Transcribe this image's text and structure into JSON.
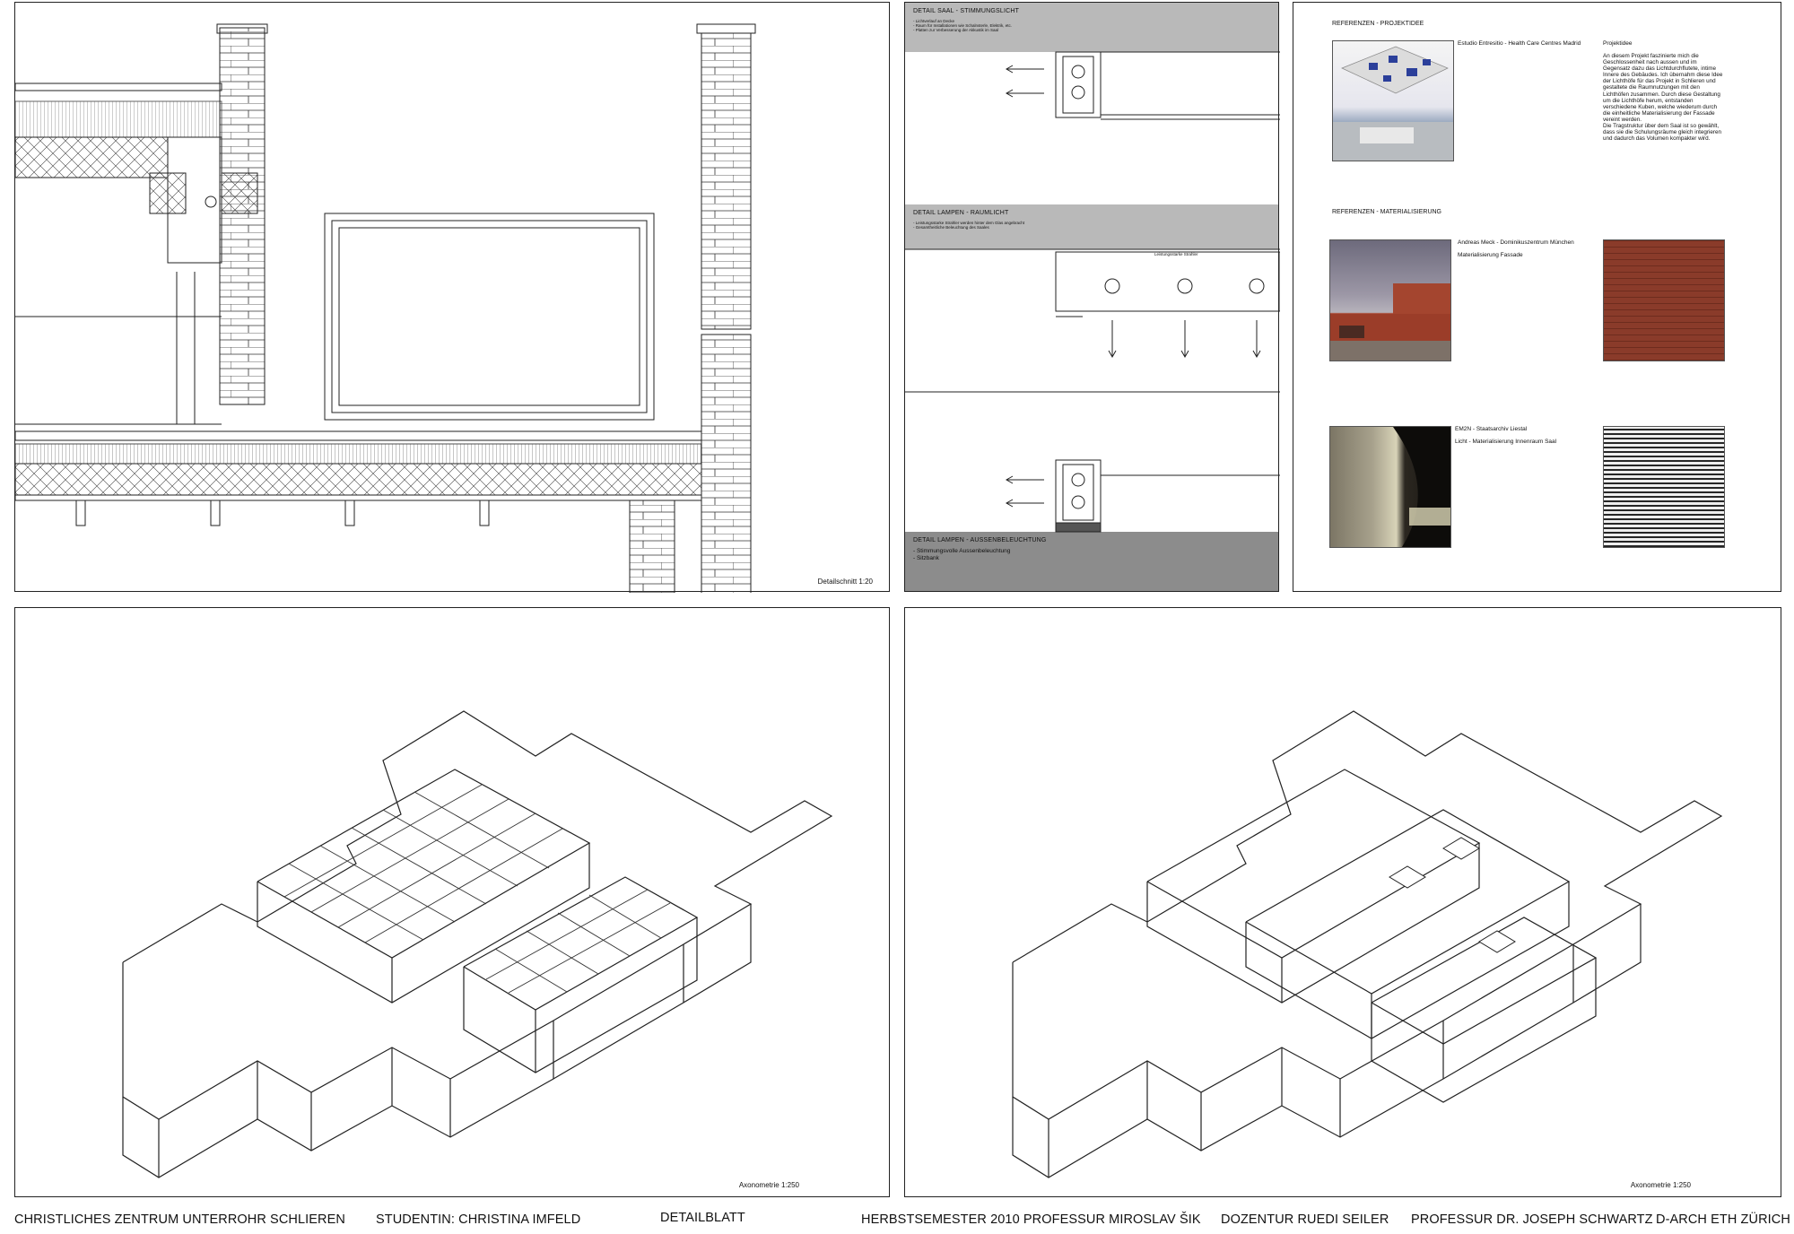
{
  "section_sheet": {
    "caption": "Detailschnitt 1:20"
  },
  "detail_sheet": {
    "band1": {
      "title": "DETAIL SAAL - STIMMUNGSLICHT",
      "items": [
        "- Lichtverlauf an Decke",
        "- Raum für Installationen wie Schalnsterle, Elektrik, etc.",
        "- Platten zur Verbesserung der Akkustik im Saal"
      ]
    },
    "band2": {
      "title": "DETAIL LAMPEN - RAUMLICHT",
      "items": [
        "- Leistungsstarke Strahler werden hinter dem Glas angebracht",
        "- Gesamtheitliche Beleuchtung des Saales"
      ]
    },
    "lamp_label": "Leistungsstarke Strahler",
    "band3": {
      "title": "DETAIL LAMPEN - AUSSENBELEUCHTUNG",
      "items": [
        "- Stimmungsvolle Aussenbeleuchtung",
        "- Sitzbank"
      ]
    }
  },
  "references": {
    "head1": "REFERENZEN - PROJEKTIDEE",
    "ref1_title": "Estudio Entresitio - Health Care Centres Madrid",
    "idea_title": "Projektidee",
    "idea_lines": [
      "An diesem Projekt faszinierte mich die",
      "Geschlossenheit nach aussen und im",
      "Gegensatz dazu das Lichtdurchflutete, intime",
      "Innere des Gebäudes. Ich übernahm diese Idee",
      "der Lichthöfe für das Projekt in Schlieren und",
      "gestaltete die Raumnutzungen mit den",
      "Lichthöfen zusammen. Durch diese Gestaltung",
      "um die Lichthöfe herum, entstanden",
      "verschiedene Kuben, welche wiederum durch",
      "die einheitliche Materialisierung der Fassade",
      "vereint werden.",
      "Die Tragstruktur über dem Saal ist so gewählt,",
      "dass sie die Schulungsräume gleich integrieren",
      "und dadurch das Volumen kompakter wird."
    ],
    "head2": "REFERENZEN - MATERIALISIERUNG",
    "ref2_title": "Andreas Meck - Dominikuszentrum München",
    "ref2_sub": "Materialisierung Fassade",
    "ref3_title": "EM2N - Staatsarchiv Liestal",
    "ref3_sub": "Licht - Materialisierung Innenraum Saal"
  },
  "axo1": {
    "caption": "Axonometrie 1:250"
  },
  "axo2": {
    "caption": "Axonometrie 1:250"
  },
  "footer": {
    "project": "CHRISTLICHES ZENTRUM UNTERROHR SCHLIEREN",
    "student": "STUDENTIN: CHRISTINA IMFELD",
    "sheet": "DETAILBLATT",
    "semester": "HERBSTSEMESTER 2010 PROFESSUR MIROSLAV ŠIK",
    "lecturer": "DOZENTUR RUEDI SEILER",
    "professor": "PROFESSUR DR. JOSEPH SCHWARTZ",
    "school": "D-ARCH ETH ZÜRICH"
  },
  "colors": {
    "band": "#b9b9b9",
    "band_dark": "#8c8c8c",
    "brick": "#8a3b2a",
    "line": "#222222"
  }
}
